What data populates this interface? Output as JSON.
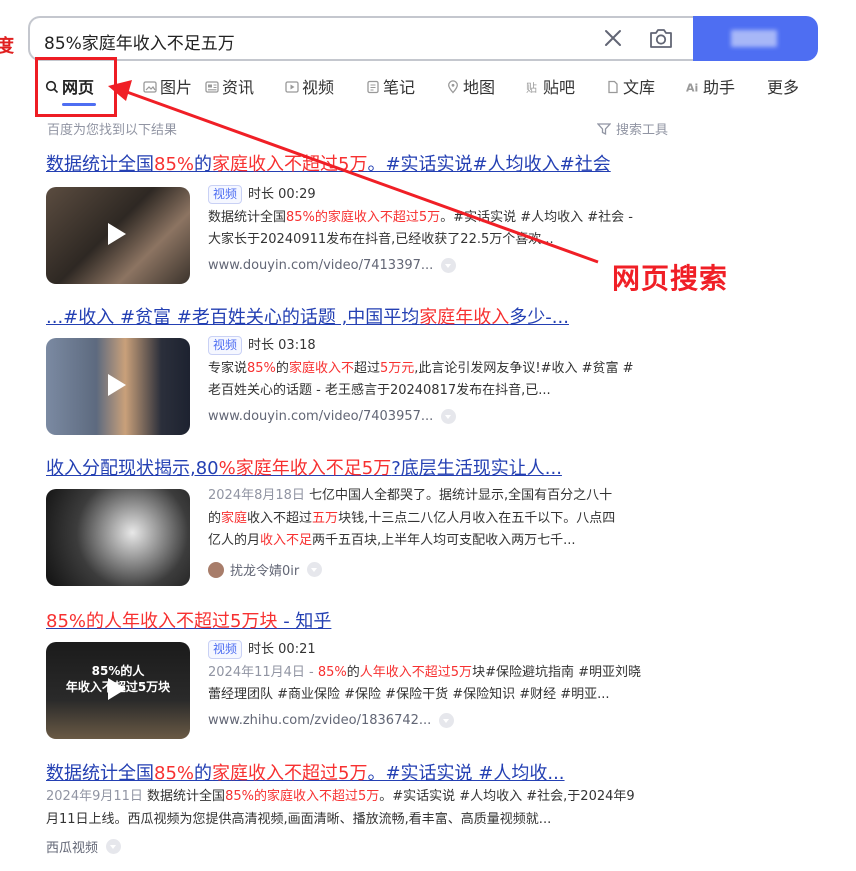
{
  "search": {
    "query": "85%家庭年收入不足五万",
    "edge_char": "度"
  },
  "tabs": [
    {
      "label": "网页",
      "icon": "search-icon",
      "active": true
    },
    {
      "label": "图片",
      "icon": "image-icon"
    },
    {
      "label": "资讯",
      "icon": "news-icon"
    },
    {
      "label": "视频",
      "icon": "video-icon"
    },
    {
      "label": "笔记",
      "icon": "note-icon"
    },
    {
      "label": "地图",
      "icon": "map-icon"
    },
    {
      "label": "贴吧",
      "icon": "tieba-icon"
    },
    {
      "label": "文库",
      "icon": "doc-icon"
    },
    {
      "label": "助手",
      "icon": "ai-icon"
    },
    {
      "label": "更多"
    }
  ],
  "found_text": "百度为您找到以下结果",
  "tools_label": "搜索工具",
  "annotation": {
    "label": "网页搜索",
    "color": "#f01f26"
  },
  "results": [
    {
      "title": [
        [
          "数据统计全国",
          0
        ],
        [
          "85%",
          1
        ],
        [
          "的",
          0
        ],
        [
          "家庭收入不超过",
          1
        ],
        [
          "5万",
          1
        ],
        [
          "。#实话实说#人均收入#社会",
          0
        ]
      ],
      "badge": "视频",
      "duration": "时长 00:29",
      "lines": [
        [
          [
            "数据统计全国",
            0
          ],
          [
            "85%的家庭收入不超过5万",
            1
          ],
          [
            "。#实话实说 #人均收入 #社会 -",
            0
          ]
        ],
        [
          [
            "大家长于20240911发布在抖音,已经收获了22.5万个喜欢...",
            0
          ]
        ]
      ],
      "source": "www.douyin.com/video/7413397..."
    },
    {
      "title": [
        [
          "...#收入 #贫富 #老百姓关心的话题 ,中国平均",
          0
        ],
        [
          "家庭年收入",
          1
        ],
        [
          "多少-...",
          0
        ]
      ],
      "badge": "视频",
      "duration": "时长 03:18",
      "lines": [
        [
          [
            "专家说",
            0
          ],
          [
            "85%",
            1
          ],
          [
            "的",
            0
          ],
          [
            "家庭收入不",
            1
          ],
          [
            "超过",
            0
          ],
          [
            "5万元",
            1
          ],
          [
            ",此言论引发网友争议!#收入 #贫富 #",
            0
          ]
        ],
        [
          [
            "老百姓关心的话题 - 老王感言于20240817发布在抖音,已...",
            0
          ]
        ]
      ],
      "source": "www.douyin.com/video/7403957..."
    },
    {
      "title": [
        [
          "收入分配现状揭示,80",
          0
        ],
        [
          "%家庭年收入不足5万",
          1
        ],
        [
          "?底层生活现实让人...",
          0
        ]
      ],
      "date": "2024年8月18日",
      "lines": [
        [
          [
            "七亿中国人全都哭了。据统计显示,全国有百分之八十",
            0
          ]
        ],
        [
          [
            "的",
            0
          ],
          [
            "家庭",
            1
          ],
          [
            "收入不超过",
            0
          ],
          [
            "五万",
            1
          ],
          [
            "块钱,十三点二八亿人月收入在五千以下。八点四",
            0
          ]
        ],
        [
          [
            "亿人的月",
            0
          ],
          [
            "收入不足",
            1
          ],
          [
            "两千五百块,上半年人均可支配收入两万七千...",
            0
          ]
        ]
      ],
      "source": "扰龙令婧0ir"
    },
    {
      "title": [
        [
          "85%的人年收入不超过5万块",
          1
        ],
        [
          " - 知乎",
          0
        ]
      ],
      "badge": "视频",
      "duration": "时长 00:21",
      "thumb_text": [
        "85%的人",
        "年收入不超过5万块"
      ],
      "date": "2024年11月4日 - ",
      "lines": [
        [
          [
            "85%",
            1
          ],
          [
            "的",
            0
          ],
          [
            "人年收入不超过5万",
            1
          ],
          [
            "块#保险避坑指南 #明亚刘晓",
            0
          ]
        ],
        [
          [
            "蕾经理团队 #商业保险 #保险 #保险干货 #保险知识 #财经 #明亚...",
            0
          ]
        ]
      ],
      "source": "www.zhihu.com/zvideo/1836742..."
    },
    {
      "title": [
        [
          "数据统计全国",
          0
        ],
        [
          "85%",
          1
        ],
        [
          "的",
          0
        ],
        [
          "家庭收入不超过",
          1
        ],
        [
          "5万",
          1
        ],
        [
          "。#实话实说 #人均收...",
          0
        ]
      ],
      "date": "2024年9月11日",
      "lines": [
        [
          [
            "数据统计全国",
            0
          ],
          [
            "85%的家庭收入不超过5万",
            1
          ],
          [
            "。#实话实说 #人均收入 #社会,于2024年9",
            0
          ]
        ],
        [
          [
            "月11日上线。西瓜视频为您提供高清视频,画面清晰、播放流畅,看丰富、高质量视频就...",
            0
          ]
        ]
      ],
      "source": "西瓜视频"
    }
  ],
  "colors": {
    "link": "#2440b3",
    "highlight": "#f73131",
    "accent": "#4e6ef2"
  }
}
